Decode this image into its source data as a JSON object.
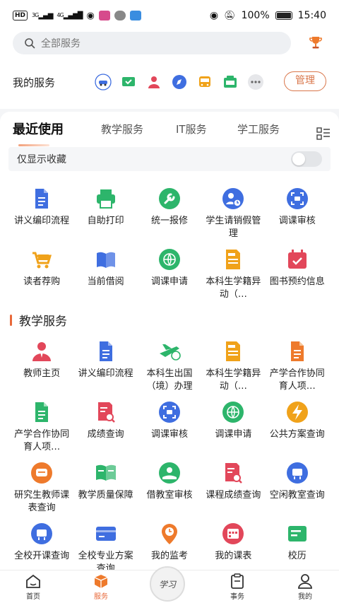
{
  "status_bar": {
    "battery": "100%",
    "time": "15:40",
    "net1": "HD",
    "net2": "3G",
    "net3": "4G"
  },
  "search": {
    "placeholder": "全部服务"
  },
  "my_services": {
    "title": "我的服务",
    "manage_label": "管理",
    "mini_icons": [
      "car-icon",
      "monitor-check-icon",
      "person-icon",
      "compass-icon",
      "bus-icon",
      "secondhand-icon",
      "more-icon"
    ]
  },
  "tabs": [
    {
      "label": "最近使用"
    },
    {
      "label": "教学服务"
    },
    {
      "label": "IT服务"
    },
    {
      "label": "学工服务"
    }
  ],
  "favorites_only": {
    "label": "仅显示收藏",
    "enabled": false
  },
  "recent": [
    {
      "label": "讲义编印流程",
      "icon": "document-icon",
      "color": "#3f6ee0"
    },
    {
      "label": "自助打印",
      "icon": "printer-icon",
      "color": "#2db56b"
    },
    {
      "label": "统一报修",
      "icon": "wrench-icon",
      "color": "#2db56b"
    },
    {
      "label": "学生请销假管理",
      "icon": "person-clock-icon",
      "color": "#3f6ee0"
    },
    {
      "label": "调课审核",
      "icon": "scan-icon",
      "color": "#3f6ee0"
    },
    {
      "label": "读者荐购",
      "icon": "cart-icon",
      "color": "#f0a21a"
    },
    {
      "label": "当前借阅",
      "icon": "book-icon",
      "color": "#3f6ee0"
    },
    {
      "label": "调课申请",
      "icon": "globe-icon",
      "color": "#2db56b"
    },
    {
      "label": "本科生学籍异动（…",
      "icon": "student-file-icon",
      "color": "#f0a21a"
    },
    {
      "label": "图书预约信息",
      "icon": "calendar-check-icon",
      "color": "#e2475a"
    }
  ],
  "teaching_section": {
    "title": "教学服务"
  },
  "teaching": [
    {
      "label": "教师主页",
      "icon": "teacher-icon",
      "color": "#e2475a"
    },
    {
      "label": "讲义编印流程",
      "icon": "document-icon",
      "color": "#3f6ee0"
    },
    {
      "label": "本科生出国（境）办理",
      "icon": "plane-icon",
      "color": "#2db56b"
    },
    {
      "label": "本科生学籍异动（…",
      "icon": "student-file-icon",
      "color": "#f0a21a"
    },
    {
      "label": "产学合作协同育人项…",
      "icon": "document-orange-icon",
      "color": "#ee7a2c"
    },
    {
      "label": "产学合作协同育人项…",
      "icon": "document-green-icon",
      "color": "#2db56b"
    },
    {
      "label": "成绩查询",
      "icon": "grade-search-icon",
      "color": "#e2475a"
    },
    {
      "label": "调课审核",
      "icon": "scan-icon",
      "color": "#3f6ee0"
    },
    {
      "label": "调课申请",
      "icon": "globe-icon",
      "color": "#2db56b"
    },
    {
      "label": "公共方案查询",
      "icon": "lightning-icon",
      "color": "#f0a21a"
    },
    {
      "label": "研究生教师课表查询",
      "icon": "chat-schedule-icon",
      "color": "#ee7a2c"
    },
    {
      "label": "教学质量保障",
      "icon": "listen-review-icon",
      "color": "#2db56b"
    },
    {
      "label": "借教室审核",
      "icon": "hand-leaf-icon",
      "color": "#2db56b"
    },
    {
      "label": "课程成绩查询",
      "icon": "grade-search-icon",
      "color": "#e2475a"
    },
    {
      "label": "空闲教室查询",
      "icon": "classroom-icon",
      "color": "#3f6ee0"
    },
    {
      "label": "全校开课查询",
      "icon": "classroom-icon",
      "color": "#3f6ee0"
    },
    {
      "label": "全校专业方案查询",
      "icon": "card-icon",
      "color": "#3f6ee0"
    },
    {
      "label": "我的监考",
      "icon": "location-clock-icon",
      "color": "#ee7a2c"
    },
    {
      "label": "我的课表",
      "icon": "timetable-icon",
      "color": "#e2475a"
    },
    {
      "label": "校历",
      "icon": "calendar-list-icon",
      "color": "#2db56b"
    }
  ],
  "bottom_nav": [
    {
      "label": "首页",
      "icon": "home-icon"
    },
    {
      "label": "服务",
      "icon": "cube-icon"
    },
    {
      "label": "学习",
      "icon": "study-logo"
    },
    {
      "label": "事务",
      "icon": "clipboard-icon"
    },
    {
      "label": "我的",
      "icon": "user-icon"
    }
  ],
  "colors": {
    "accent": "#e8693a",
    "blue": "#3f6ee0",
    "green": "#2db56b",
    "orange": "#f0a21a",
    "red": "#e2475a"
  }
}
